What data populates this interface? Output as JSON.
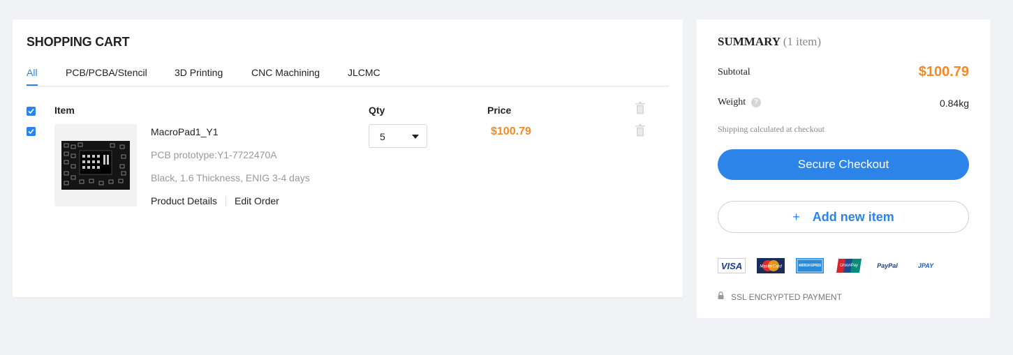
{
  "cart": {
    "title": "SHOPPING CART",
    "tabs": [
      {
        "label": "All"
      },
      {
        "label": "PCB/PCBA/Stencil"
      },
      {
        "label": "3D Printing"
      },
      {
        "label": "CNC Machining"
      },
      {
        "label": "JLCMC"
      }
    ],
    "active_tab": "All",
    "headers": {
      "item": "Item",
      "qty": "Qty",
      "price": "Price"
    },
    "items": [
      {
        "name": "MacroPad1_Y1",
        "subtitle": "PCB prototype:Y1-7722470A",
        "specs": "Black, 1.6 Thickness, ENIG 3-4 days",
        "details_link": "Product Details",
        "edit_link": "Edit Order",
        "qty": "5",
        "price": "$100.79",
        "checked": true
      }
    ],
    "select_all_checked": true
  },
  "summary": {
    "title": "SUMMARY",
    "count": "(1 item)",
    "subtotal_label": "Subtotal",
    "subtotal_value": "$100.79",
    "weight_label": "Weight",
    "weight_value": "0.84kg",
    "shipping_note": "Shipping calculated at checkout",
    "checkout_label": "Secure Checkout",
    "add_item_plus": "+",
    "add_item_label": "Add new item",
    "payment_methods": [
      "VISA",
      "MasterCard",
      "AMERICAN EXPRESS",
      "UnionPay",
      "PayPal",
      "JPAY"
    ],
    "ssl_text": "SSL ENCRYPTED PAYMENT"
  },
  "colors": {
    "accent": "#2c84e8",
    "price": "#f58a25",
    "background": "#f1f2f6"
  },
  "icons": [
    "checkbox-checked-icon",
    "trash-icon",
    "chevron-down-icon",
    "help-icon",
    "lock-icon"
  ]
}
